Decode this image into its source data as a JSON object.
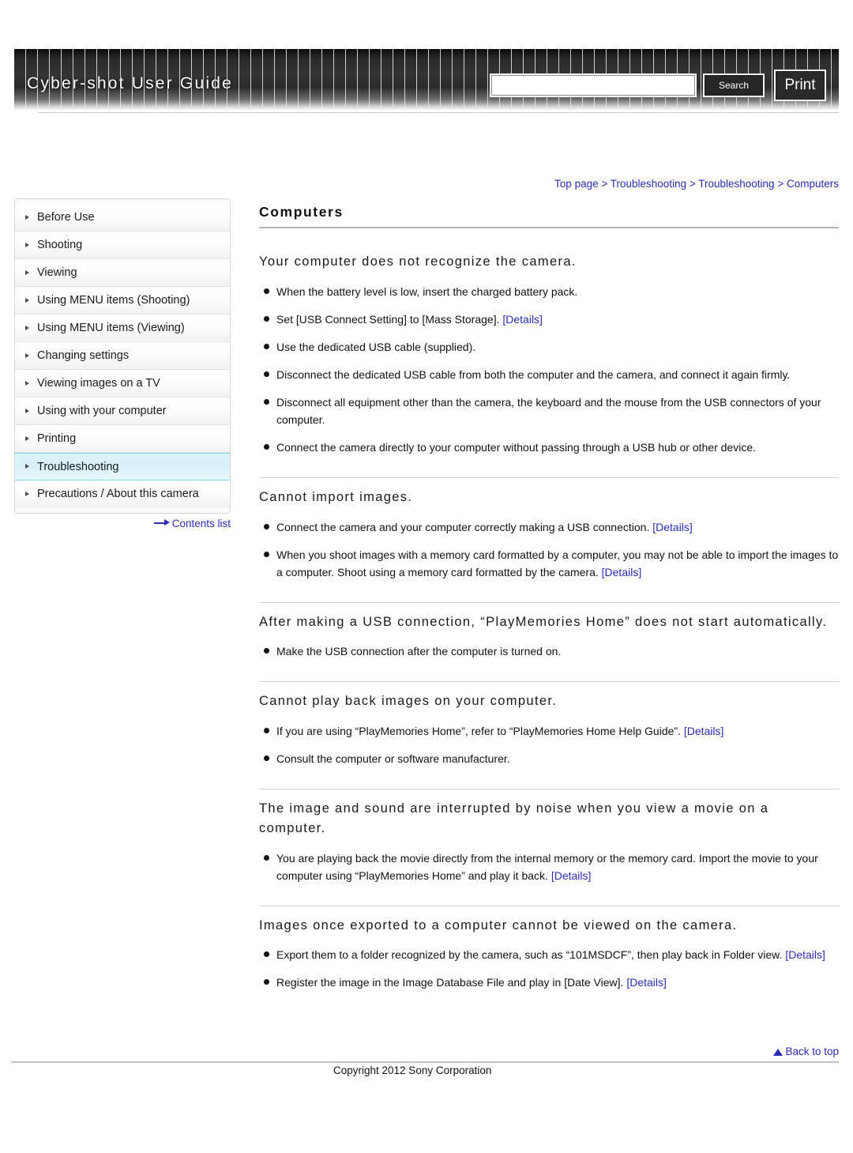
{
  "header": {
    "site_title": "Cyber-shot User Guide",
    "search_value": "",
    "search_placeholder": "",
    "search_button": "Search",
    "print_button": "Print"
  },
  "breadcrumb": {
    "items": [
      "Top page",
      "Troubleshooting",
      "Troubleshooting",
      "Computers"
    ],
    "separator": ">"
  },
  "sidebar": {
    "items": [
      {
        "label": "Before Use",
        "active": false
      },
      {
        "label": "Shooting",
        "active": false
      },
      {
        "label": "Viewing",
        "active": false
      },
      {
        "label": "Using MENU items (Shooting)",
        "active": false
      },
      {
        "label": "Using MENU items (Viewing)",
        "active": false
      },
      {
        "label": "Changing settings",
        "active": false
      },
      {
        "label": "Viewing images on a TV",
        "active": false
      },
      {
        "label": "Using with your computer",
        "active": false
      },
      {
        "label": "Printing",
        "active": false
      },
      {
        "label": "Troubleshooting",
        "active": true
      },
      {
        "label": "Precautions / About this camera",
        "active": false
      }
    ],
    "contents_link": "Contents list"
  },
  "main": {
    "page_title": "Computers",
    "sections": [
      {
        "heading": "Your computer does not recognize the camera.",
        "bullets": [
          [
            {
              "t": "text",
              "v": "When the battery level is low, insert the charged battery pack."
            }
          ],
          [
            {
              "t": "text",
              "v": "Set [USB Connect Setting] to [Mass Storage]. "
            },
            {
              "t": "link",
              "v": "[Details]"
            }
          ],
          [
            {
              "t": "text",
              "v": "Use the dedicated USB cable (supplied)."
            }
          ],
          [
            {
              "t": "text",
              "v": "Disconnect the dedicated USB cable from both the computer and the camera, and connect it again firmly."
            }
          ],
          [
            {
              "t": "text",
              "v": "Disconnect all equipment other than the camera, the keyboard and the mouse from the USB connectors of your computer."
            }
          ],
          [
            {
              "t": "text",
              "v": "Connect the camera directly to your computer without passing through a USB hub or other device."
            }
          ]
        ]
      },
      {
        "heading": "Cannot import images.",
        "bullets": [
          [
            {
              "t": "text",
              "v": "Connect the camera and your computer correctly making a USB connection. "
            },
            {
              "t": "link",
              "v": "[Details]"
            }
          ],
          [
            {
              "t": "text",
              "v": "When you shoot images with a memory card formatted by a computer, you may not be able to import the images to a computer. Shoot using a memory card formatted by the camera. "
            },
            {
              "t": "link",
              "v": "[Details]"
            }
          ]
        ]
      },
      {
        "heading": "After making a USB connection, “PlayMemories Home” does not start automatically.",
        "bullets": [
          [
            {
              "t": "text",
              "v": "Make the USB connection after the computer is turned on."
            }
          ]
        ]
      },
      {
        "heading": "Cannot play back images on your computer.",
        "bullets": [
          [
            {
              "t": "text",
              "v": "If you are using “PlayMemories Home”, refer to “PlayMemories Home Help Guide”. "
            },
            {
              "t": "link",
              "v": "[Details]"
            }
          ],
          [
            {
              "t": "text",
              "v": "Consult the computer or software manufacturer."
            }
          ]
        ]
      },
      {
        "heading": "The image and sound are interrupted by noise when you view a movie on a computer.",
        "bullets": [
          [
            {
              "t": "text",
              "v": "You are playing back the movie directly from the internal memory or the memory card. Import the movie to your computer using “PlayMemories Home” and play it back. "
            },
            {
              "t": "link",
              "v": "[Details]"
            }
          ]
        ]
      },
      {
        "heading": "Images once exported to a computer cannot be viewed on the camera.",
        "bullets": [
          [
            {
              "t": "text",
              "v": "Export them to a folder recognized by the camera, such as “101MSDCF”, then play back in Folder view. "
            },
            {
              "t": "link",
              "v": "[Details]"
            }
          ],
          [
            {
              "t": "text",
              "v": "Register the image in the Image Database File and play in [Date View]. "
            },
            {
              "t": "link",
              "v": "[Details]"
            }
          ]
        ]
      }
    ]
  },
  "footer": {
    "back_to_top": "Back to top",
    "copyright": "Copyright 2012 Sony Corporation"
  },
  "colors": {
    "link": "#2b2bb5",
    "active_nav_border": "#7fd2ea",
    "active_nav_bg": "#d7f0fa"
  }
}
